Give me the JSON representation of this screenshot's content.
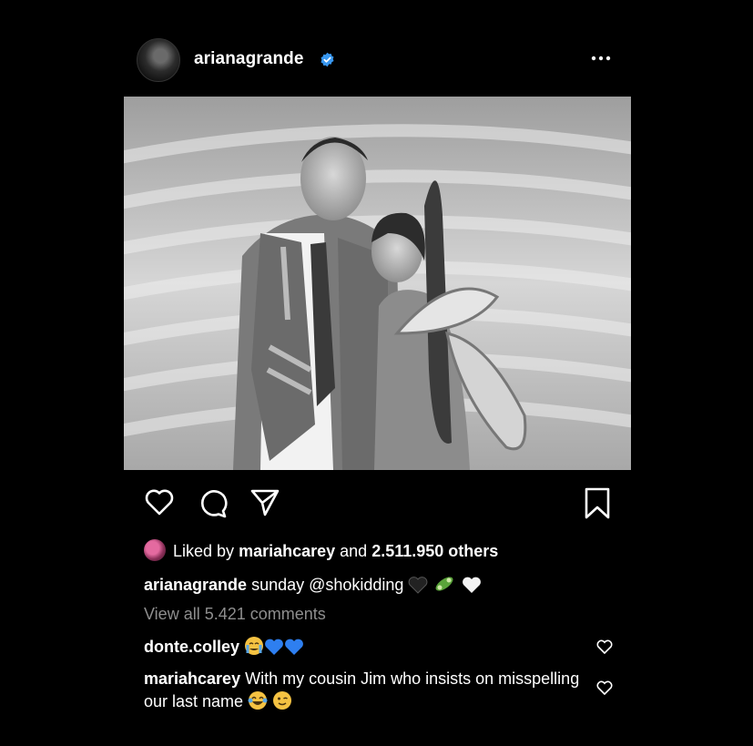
{
  "post": {
    "username": "arianagrande",
    "verified": true
  },
  "likes": {
    "prefix": "Liked by",
    "by_user": "mariahcarey",
    "middle": "and",
    "count_text": "2.511.950 others"
  },
  "caption": {
    "user": "arianagrande",
    "text": "sunday @shokidding",
    "emojis": [
      "black-heart",
      "cucumber",
      "white-heart"
    ]
  },
  "view_all_comments": "View all 5.421 comments",
  "comments": [
    {
      "user": "donte.colley",
      "text": "",
      "emojis": [
        "crying-face",
        "blue-heart",
        "blue-heart"
      ]
    },
    {
      "user": "mariahcarey",
      "text": "With my cousin Jim who insists on misspelling our last name",
      "emojis": [
        "tears-of-joy",
        "winking-face"
      ]
    }
  ],
  "icons": [
    "more-options-icon",
    "like-icon",
    "comment-icon",
    "share-icon",
    "save-icon",
    "verified-badge-icon"
  ],
  "colors": {
    "background": "#000000",
    "text": "#ffffff",
    "secondary": "#8e8e8e",
    "verified": "#3897f0"
  }
}
